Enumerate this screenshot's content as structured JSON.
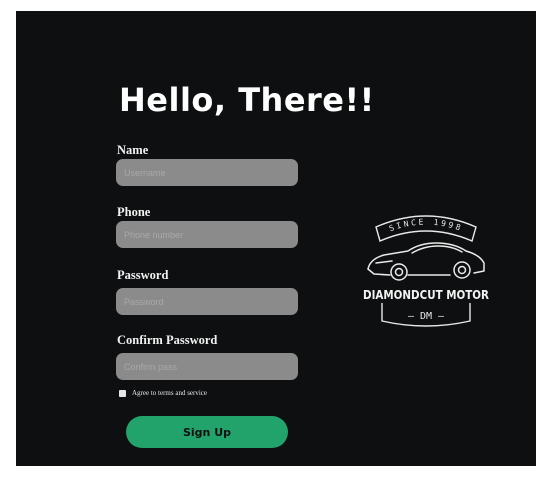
{
  "form": {
    "title": "Hello, There!!",
    "fields": [
      {
        "label": "Name",
        "placeholder": "Username"
      },
      {
        "label": "Phone",
        "placeholder": "Phone number"
      },
      {
        "label": "Password",
        "placeholder": "Password"
      },
      {
        "label": "Confirm Password",
        "placeholder": "Confirm pass"
      }
    ],
    "terms_label": "Agree to terms and service",
    "signup_label": "Sign Up"
  },
  "logo": {
    "since": "SINCE 1998",
    "brand": "DIAMONDCUT MOTOR",
    "initials": "— DM —"
  },
  "colors": {
    "panel": "#0d0f10",
    "input": "#8b8b8b",
    "accent": "#21a36b"
  }
}
